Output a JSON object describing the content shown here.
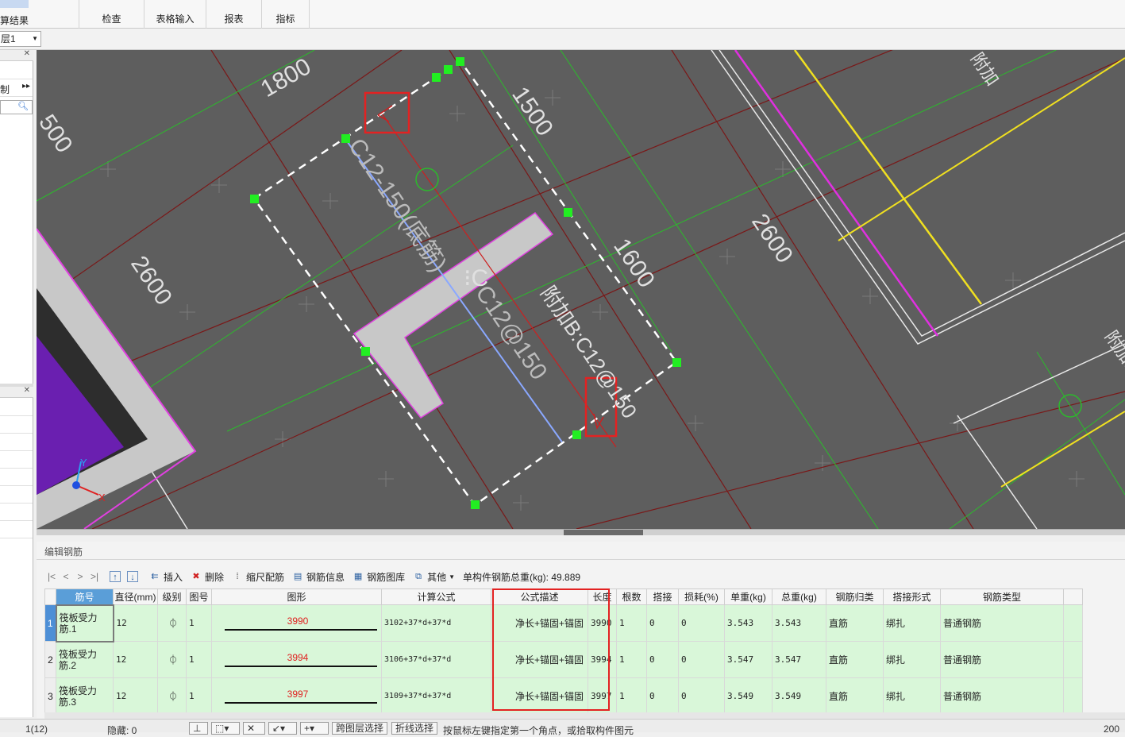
{
  "ribbon": {
    "calc_result_label": "算结果",
    "groups": [
      {
        "label": "检查"
      },
      {
        "label": "表格输入"
      },
      {
        "label": "报表"
      },
      {
        "label": "指标"
      }
    ]
  },
  "toolbar": {
    "floor_value": "层1"
  },
  "left_panel": {
    "top_item_label": "制"
  },
  "viewport": {
    "dim_1800": "1800",
    "dim_1500": "1500",
    "dim_500": "500",
    "dim_2600_left": "2600",
    "dim_2600_right": "2600",
    "dim_1600": "1600",
    "rebar_label_1": "C12-150(底筋)",
    "rebar_label_2": "C12@150",
    "rebar_label_3": "附加B:C12@150",
    "rebar_label_4": "附加",
    "rebar_label_5": "附加B",
    "axis_x": "X",
    "axis_y": "Y"
  },
  "edit_panel": {
    "title": "编辑钢筋",
    "nav": [
      "|<",
      "<",
      ">",
      ">|"
    ],
    "buttons": [
      {
        "label": "插入",
        "icon": "insert-icon"
      },
      {
        "label": "删除",
        "icon": "delete-icon"
      },
      {
        "label": "缩尺配筋",
        "icon": "scale-icon"
      },
      {
        "label": "钢筋信息",
        "icon": "info-icon"
      },
      {
        "label": "钢筋图库",
        "icon": "library-icon"
      },
      {
        "label": "其他",
        "icon": "other-icon"
      }
    ],
    "weight_text": "单构件钢筋总重(kg): 49.889"
  },
  "table": {
    "headers": [
      "筋号",
      "直径(mm)",
      "级别",
      "图号",
      "图形",
      "计算公式",
      "公式描述",
      "长度",
      "根数",
      "搭接",
      "损耗(%)",
      "单重(kg)",
      "总重(kg)",
      "钢筋归类",
      "搭接形式",
      "钢筋类型"
    ],
    "rows": [
      {
        "num": "1",
        "name": "筏板受力筋.1",
        "diameter": "12",
        "grade": "⏀",
        "fig": "1",
        "shape_len": "3990",
        "formula": "3102+37*d+37*d",
        "desc": "净长+锚固+锚固",
        "length": "3990",
        "count": "1",
        "lap": "0",
        "loss": "0",
        "unit_wt": "3.543",
        "total_wt": "3.543",
        "category": "直筋",
        "lap_form": "绑扎",
        "type": "普通钢筋"
      },
      {
        "num": "2",
        "name": "筏板受力筋.2",
        "diameter": "12",
        "grade": "⏀",
        "fig": "1",
        "shape_len": "3994",
        "formula": "3106+37*d+37*d",
        "desc": "净长+锚固+锚固",
        "length": "3994",
        "count": "1",
        "lap": "0",
        "loss": "0",
        "unit_wt": "3.547",
        "total_wt": "3.547",
        "category": "直筋",
        "lap_form": "绑扎",
        "type": "普通钢筋"
      },
      {
        "num": "3",
        "name": "筏板受力筋.3",
        "diameter": "12",
        "grade": "⏀",
        "fig": "1",
        "shape_len": "3997",
        "formula": "3109+37*d+37*d",
        "desc": "净长+锚固+锚固",
        "length": "3997",
        "count": "1",
        "lap": "0",
        "loss": "0",
        "unit_wt": "3.549",
        "total_wt": "3.549",
        "category": "直筋",
        "lap_form": "绑扎",
        "type": "普通钢筋"
      }
    ]
  },
  "status": {
    "page": "1(12)",
    "hidden": "隐藏: 0",
    "btn_layer": "跨图层选择",
    "btn_polyline": "折线选择",
    "hint": "按鼠标左键指定第一个角点，或拾取构件图元",
    "right_value": "200"
  }
}
